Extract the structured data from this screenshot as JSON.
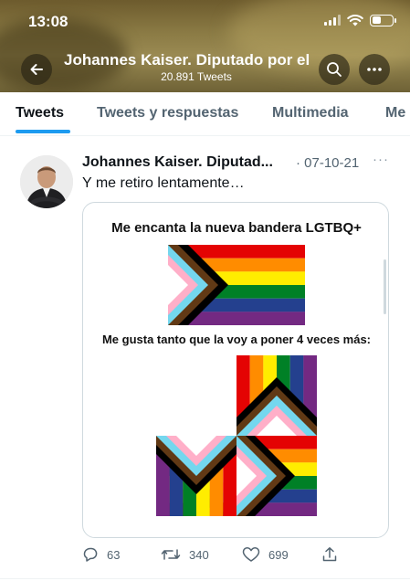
{
  "status_bar": {
    "time": "13:08"
  },
  "header": {
    "title": "Johannes Kaiser. Diputado por el",
    "tweet_count": "20.891 Tweets"
  },
  "tabs": [
    {
      "label": "Tweets",
      "active": true
    },
    {
      "label": "Tweets y respuestas",
      "active": false
    },
    {
      "label": "Multimedia",
      "active": false
    },
    {
      "label": "Me",
      "active": false
    }
  ],
  "tweet": {
    "author": "Johannes Kaiser. Diputad...",
    "date": "· 07-10-21",
    "more": "···",
    "text": "Y me retiro lentamente…",
    "media": {
      "line1": "Me encanta la nueva bandera LGTBQ+",
      "line2": "Me gusta tanto que la voy a poner 4 veces más:"
    },
    "actions": {
      "replies": "63",
      "retweets": "340",
      "likes": "699"
    }
  },
  "icons": {
    "back": "arrow-left-icon",
    "search": "search-icon",
    "more": "more-icon",
    "reply": "reply-icon",
    "retweet": "retweet-icon",
    "like": "heart-icon",
    "share": "share-icon"
  },
  "colors": {
    "accent": "#1d9bf0",
    "secondary_text": "#536471"
  }
}
